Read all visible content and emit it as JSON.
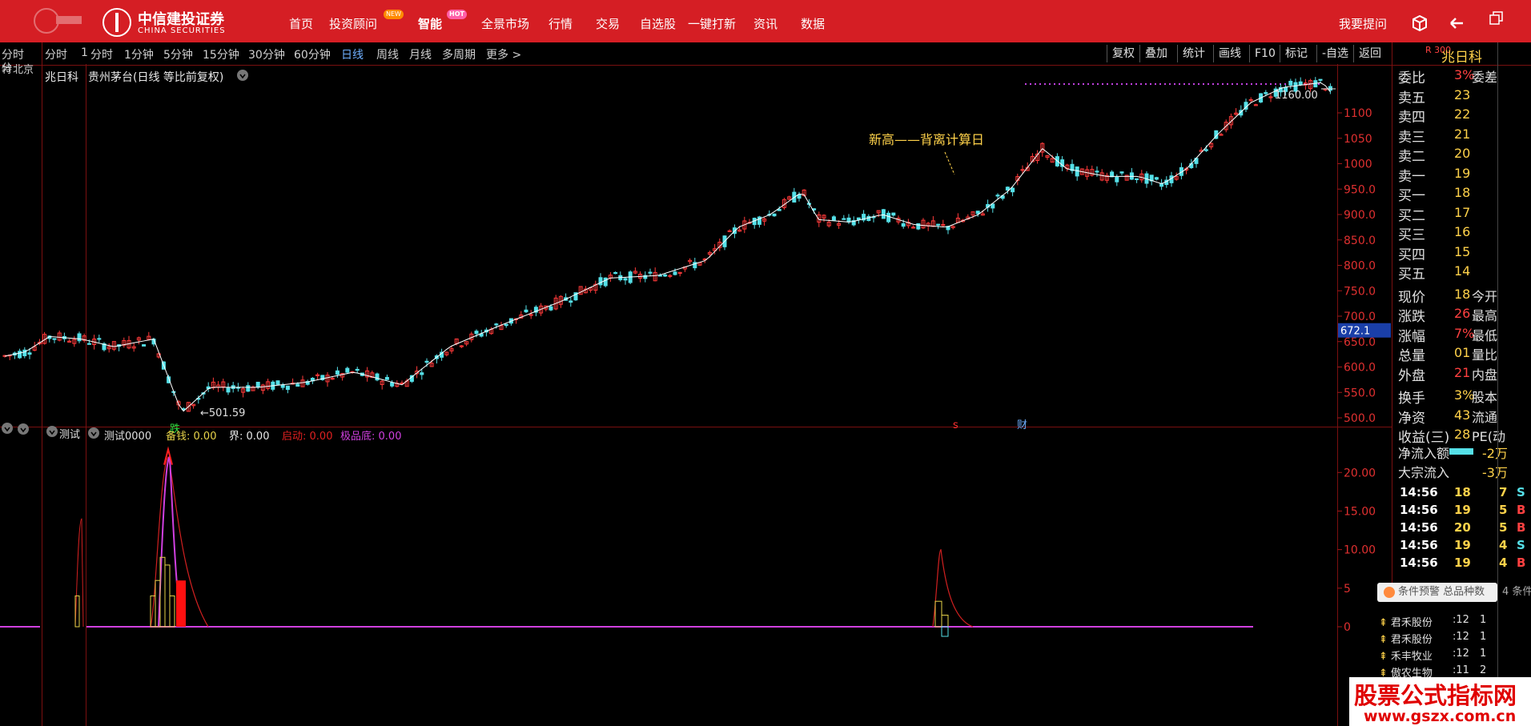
{
  "brand": {
    "name_cn": "中信建投证券",
    "name_en": "CHINA SECURITIES"
  },
  "nav": [
    {
      "label": "首页"
    },
    {
      "label": "投资顾问",
      "badge": "NEW"
    },
    {
      "label": "智能",
      "badge": "HOT"
    },
    {
      "label": "全景市场"
    },
    {
      "label": "行情"
    },
    {
      "label": "交易"
    },
    {
      "label": "自选股"
    },
    {
      "label": "一键打新"
    },
    {
      "label": "资讯"
    },
    {
      "label": "数据"
    }
  ],
  "top_right": {
    "ask": "我要提问",
    "icons": [
      "cube-icon",
      "back-arrow-icon",
      "restore-window-icon"
    ]
  },
  "left_tabs": [
    "分时",
    "分",
    "特",
    "北京"
  ],
  "period_tabs": [
    "分时",
    "1",
    "分时",
    "1分钟",
    "5分钟",
    "15分钟",
    "30分钟",
    "60分钟",
    "日线",
    "周线",
    "月线",
    "多周期",
    "更多 >"
  ],
  "active_period": "日线",
  "tools": [
    "复权",
    "叠加",
    "统计",
    "画线",
    "F10",
    "标记",
    "-自选",
    "返回"
  ],
  "stock": {
    "left_name": "兆日科",
    "title": "贵州茅台(日线 等比前复权)",
    "right_name": "兆日科",
    "right_code": "R 300"
  },
  "price_axis": {
    "ticks": [
      "1100",
      "1050",
      "1000",
      "950.0",
      "900.0",
      "850.0",
      "800.0",
      "750.0",
      "700.0",
      "650.0",
      "600.0",
      "550.0",
      "500.0"
    ],
    "current_price": "672.1"
  },
  "annotations": {
    "high": "1160.00",
    "low": "501.59",
    "new_high_note": "新高——背离计算日",
    "fall_label": "跌",
    "s_mark": "s",
    "cai_mark": "财"
  },
  "indicator": {
    "left_tab": "测试",
    "name": "测试0000",
    "values": [
      {
        "label": "备钱:",
        "value": "0.00",
        "color": "#e8d44a"
      },
      {
        "label": "界:",
        "value": "0.00",
        "color": "#e8e8e8"
      },
      {
        "label": "启动:",
        "value": "0.00",
        "color": "#e02020"
      },
      {
        "label": "极品底:",
        "value": "0.00",
        "color": "#d040e0"
      }
    ],
    "axis": [
      "20.00",
      "15.00",
      "10.00",
      "5",
      "0"
    ]
  },
  "quote": {
    "rows": [
      {
        "label": "委比",
        "val": "3%",
        "extra": "委差"
      },
      {
        "label": "卖五",
        "val": "23"
      },
      {
        "label": "卖四",
        "val": "22"
      },
      {
        "label": "卖三",
        "val": "21"
      },
      {
        "label": "卖二",
        "val": "20"
      },
      {
        "label": "卖一",
        "val": "19"
      },
      {
        "label": "买一",
        "val": "18"
      },
      {
        "label": "买二",
        "val": "17"
      },
      {
        "label": "买三",
        "val": "16"
      },
      {
        "label": "买四",
        "val": "15"
      },
      {
        "label": "买五",
        "val": "14"
      },
      {
        "label": "现价",
        "val": "18",
        "extra": "今开"
      },
      {
        "label": "涨跌",
        "val": "26",
        "extra": "最高"
      },
      {
        "label": "涨幅",
        "val": "7%",
        "extra": "最低"
      },
      {
        "label": "总量",
        "val": "01",
        "extra": "量比"
      },
      {
        "label": "外盘",
        "val": "21",
        "extra": "内盘"
      },
      {
        "label": "换手",
        "val": "3%",
        "extra": "股本"
      },
      {
        "label": "净资",
        "val": "43",
        "extra": "流通"
      },
      {
        "label": "收益(三)",
        "val": "28",
        "extra": "PE(动"
      }
    ],
    "flow": [
      {
        "label": "净流入额",
        "val": "-2万"
      },
      {
        "label": "大宗流入",
        "val": "-3万"
      }
    ],
    "ticks": [
      {
        "time": "14:56",
        "price": "18",
        "vol": "7",
        "side": "S"
      },
      {
        "time": "14:56",
        "price": "19",
        "vol": "5",
        "side": "B"
      },
      {
        "time": "14:56",
        "price": "20",
        "vol": "5",
        "side": "B"
      },
      {
        "time": "14:56",
        "price": "19",
        "vol": "4",
        "side": "S"
      },
      {
        "time": "14:56",
        "price": "19",
        "vol": "4",
        "side": "B"
      }
    ]
  },
  "alert": {
    "text": "条件预警 总品种数",
    "count": "4 条件"
  },
  "watchlist": [
    {
      "name": "君禾股份",
      "val": ":12",
      "n": "1"
    },
    {
      "name": "君禾股份",
      "val": ":12",
      "n": "1"
    },
    {
      "name": "禾丰牧业",
      "val": ":12",
      "n": "1"
    },
    {
      "name": "傲农生物",
      "val": ":11",
      "n": "2"
    }
  ],
  "watermark": {
    "line1": "股票公式指标网",
    "line2": "www.gszx.com.cn"
  },
  "colors": {
    "up": "#ff3a3a",
    "down": "#55e0e8",
    "ma": "#ffffff",
    "accent": "#d51e24"
  }
}
